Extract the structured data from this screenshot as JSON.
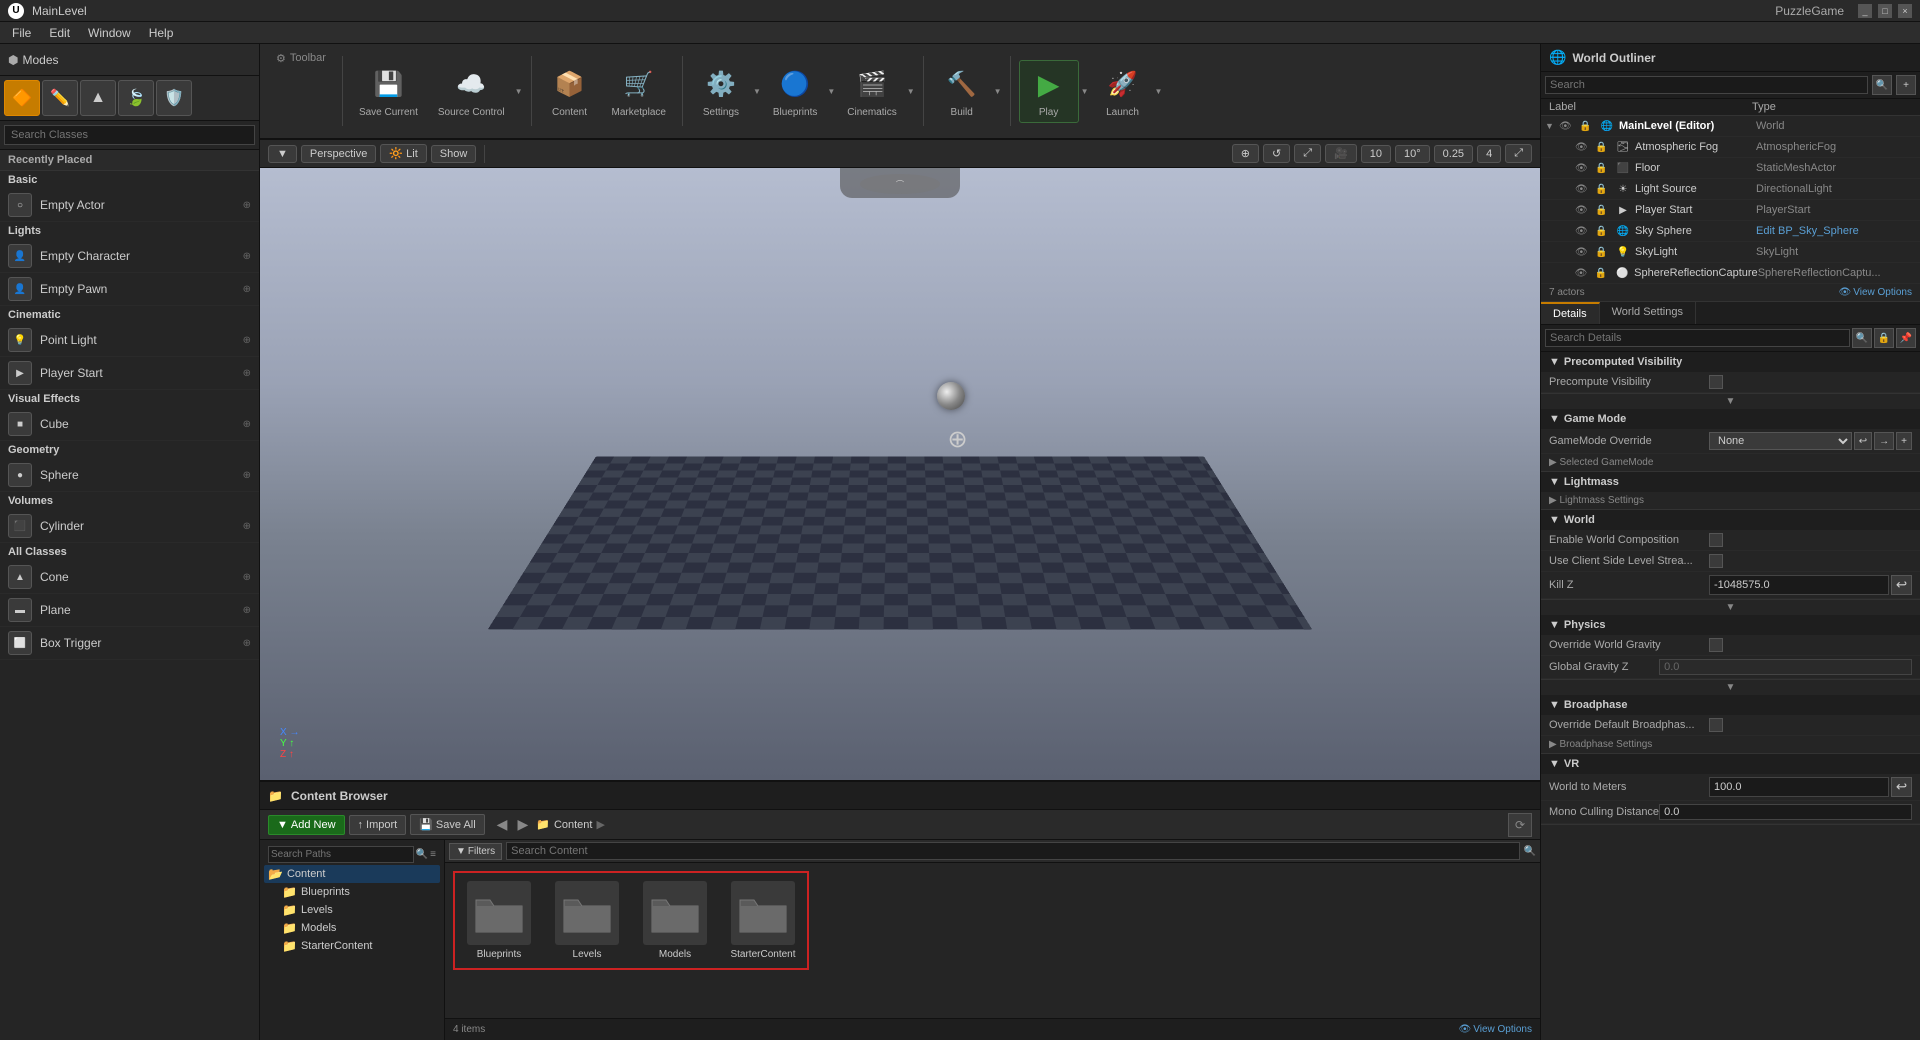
{
  "titlebar": {
    "logo": "U",
    "title": "MainLevel",
    "app_name": "PuzzleGame",
    "controls": [
      "_",
      "□",
      "×"
    ]
  },
  "menubar": {
    "items": [
      "File",
      "Edit",
      "Window",
      "Help"
    ]
  },
  "leftpanel": {
    "modes_label": "Modes",
    "mode_icons": [
      "🔶",
      "✏️",
      "▲",
      "🍃",
      "🛡️"
    ],
    "search_placeholder": "Search Classes",
    "recently_placed": "Recently Placed",
    "categories": {
      "basic": "Basic",
      "lights": "Lights",
      "cinematic": "Cinematic",
      "visual_effects": "Visual Effects",
      "geometry": "Geometry",
      "volumes": "Volumes",
      "all_classes": "All Classes"
    },
    "actors": [
      {
        "name": "Empty Actor",
        "icon": "○"
      },
      {
        "name": "Empty Character",
        "icon": "👤"
      },
      {
        "name": "Empty Pawn",
        "icon": "👤"
      },
      {
        "name": "Point Light",
        "icon": "💡"
      },
      {
        "name": "Player Start",
        "icon": "▶"
      },
      {
        "name": "Cube",
        "icon": "■"
      },
      {
        "name": "Sphere",
        "icon": "●"
      },
      {
        "name": "Cylinder",
        "icon": "⬛"
      },
      {
        "name": "Cone",
        "icon": "▲"
      },
      {
        "name": "Plane",
        "icon": "▬"
      },
      {
        "name": "Box Trigger",
        "icon": "⬜"
      }
    ]
  },
  "toolbar": {
    "label": "Toolbar",
    "items": [
      {
        "icon": "💾",
        "label": "Save Current",
        "has_arrow": false
      },
      {
        "icon": "☁️",
        "label": "Source Control",
        "has_arrow": true
      },
      {
        "icon": "📦",
        "label": "Content",
        "has_arrow": false
      },
      {
        "icon": "🛒",
        "label": "Marketplace",
        "has_arrow": false
      },
      {
        "icon": "⚙️",
        "label": "Settings",
        "has_arrow": true
      },
      {
        "icon": "🔵",
        "label": "Blueprints",
        "has_arrow": true
      },
      {
        "icon": "🎬",
        "label": "Cinematics",
        "has_arrow": true
      },
      {
        "icon": "🔨",
        "label": "Build",
        "has_arrow": true
      },
      {
        "icon": "▶",
        "label": "Play",
        "has_arrow": true,
        "type": "play"
      },
      {
        "icon": "🚀",
        "label": "Launch",
        "has_arrow": true
      }
    ]
  },
  "viewport_toolbar": {
    "perspective": "Perspective",
    "lit": "Lit",
    "show": "Show",
    "grid_size": "10",
    "rotation": "10°",
    "scale": "0.25",
    "num": "4"
  },
  "viewport": {
    "gizmo_label": ""
  },
  "world_outliner": {
    "title": "World Outliner",
    "search_placeholder": "Search",
    "columns": {
      "label": "Label",
      "type": "Type"
    },
    "actors_count": "7 actors",
    "view_options": "View Options",
    "items": [
      {
        "name": "MainLevel (Editor)",
        "type": "World",
        "indent": 0,
        "bold": true,
        "icon": "🌐"
      },
      {
        "name": "Atmospheric Fog",
        "type": "AtmosphericFog",
        "indent": 1,
        "icon": "🌫️"
      },
      {
        "name": "Floor",
        "type": "StaticMeshActor",
        "indent": 1,
        "icon": "⬛"
      },
      {
        "name": "Light Source",
        "type": "DirectionalLight",
        "indent": 1,
        "icon": "☀️"
      },
      {
        "name": "Player Start",
        "type": "PlayerStart",
        "indent": 1,
        "icon": "▶"
      },
      {
        "name": "Sky Sphere",
        "type": "Edit BP_Sky_Sphere",
        "indent": 1,
        "icon": "🌐",
        "type_is_link": true
      },
      {
        "name": "SkyLight",
        "type": "SkyLight",
        "indent": 1,
        "icon": "💡"
      },
      {
        "name": "SphereReflectionCapture",
        "type": "SphereReflectionCaptu...",
        "indent": 1,
        "icon": "⚪"
      }
    ]
  },
  "details": {
    "tabs": [
      "Details",
      "World Settings"
    ],
    "search_placeholder": "Search Details",
    "sections": {
      "precomputed_visibility": {
        "title": "Precomputed Visibility",
        "rows": [
          {
            "label": "Precompute Visibility",
            "type": "checkbox"
          }
        ]
      },
      "game_mode": {
        "title": "Game Mode",
        "rows": [
          {
            "label": "GameMode Override",
            "type": "select",
            "value": "None"
          },
          {
            "label": "Selected GameMode",
            "type": "expander"
          }
        ]
      },
      "lightmass": {
        "title": "Lightmass",
        "rows": [
          {
            "label": "Lightmass Settings",
            "type": "expander"
          }
        ]
      },
      "world": {
        "title": "World",
        "rows": [
          {
            "label": "Enable World Composition",
            "type": "checkbox"
          },
          {
            "label": "Use Client Side Level Strea...",
            "type": "checkbox"
          },
          {
            "label": "Kill Z",
            "type": "input",
            "value": "-1048575.0"
          }
        ]
      },
      "physics": {
        "title": "Physics",
        "rows": [
          {
            "label": "Override World Gravity",
            "type": "checkbox"
          },
          {
            "label": "Global Gravity Z",
            "type": "input",
            "value": "0.0",
            "disabled": true
          }
        ]
      },
      "broadphase": {
        "title": "Broadphase",
        "rows": [
          {
            "label": "Override Default Broadphas...",
            "type": "checkbox"
          },
          {
            "label": "Broadphase Settings",
            "type": "expander"
          }
        ]
      },
      "vr": {
        "title": "VR",
        "rows": [
          {
            "label": "World to Meters",
            "type": "input",
            "value": "100.0"
          },
          {
            "label": "Mono Culling Distance",
            "type": "input",
            "value": "0.0"
          }
        ]
      }
    }
  },
  "bottom_panel": {
    "title": "Content Browser",
    "add_new": "Add New",
    "import": "Import",
    "save_all": "Save All",
    "filters": "Filters",
    "search_placeholder": "Search Content",
    "breadcrumb": [
      "Content"
    ],
    "items_count": "4 items",
    "view_options": "View Options",
    "folders": [
      {
        "name": "Blueprints"
      },
      {
        "name": "Levels"
      },
      {
        "name": "Models"
      },
      {
        "name": "StarterContent"
      }
    ],
    "folder_tree": [
      {
        "name": "Content",
        "indent": 0,
        "selected": true,
        "expanded": true
      },
      {
        "name": "Blueprints",
        "indent": 1
      },
      {
        "name": "Levels",
        "indent": 1
      },
      {
        "name": "Models",
        "indent": 1
      },
      {
        "name": "StarterContent",
        "indent": 1
      }
    ]
  }
}
